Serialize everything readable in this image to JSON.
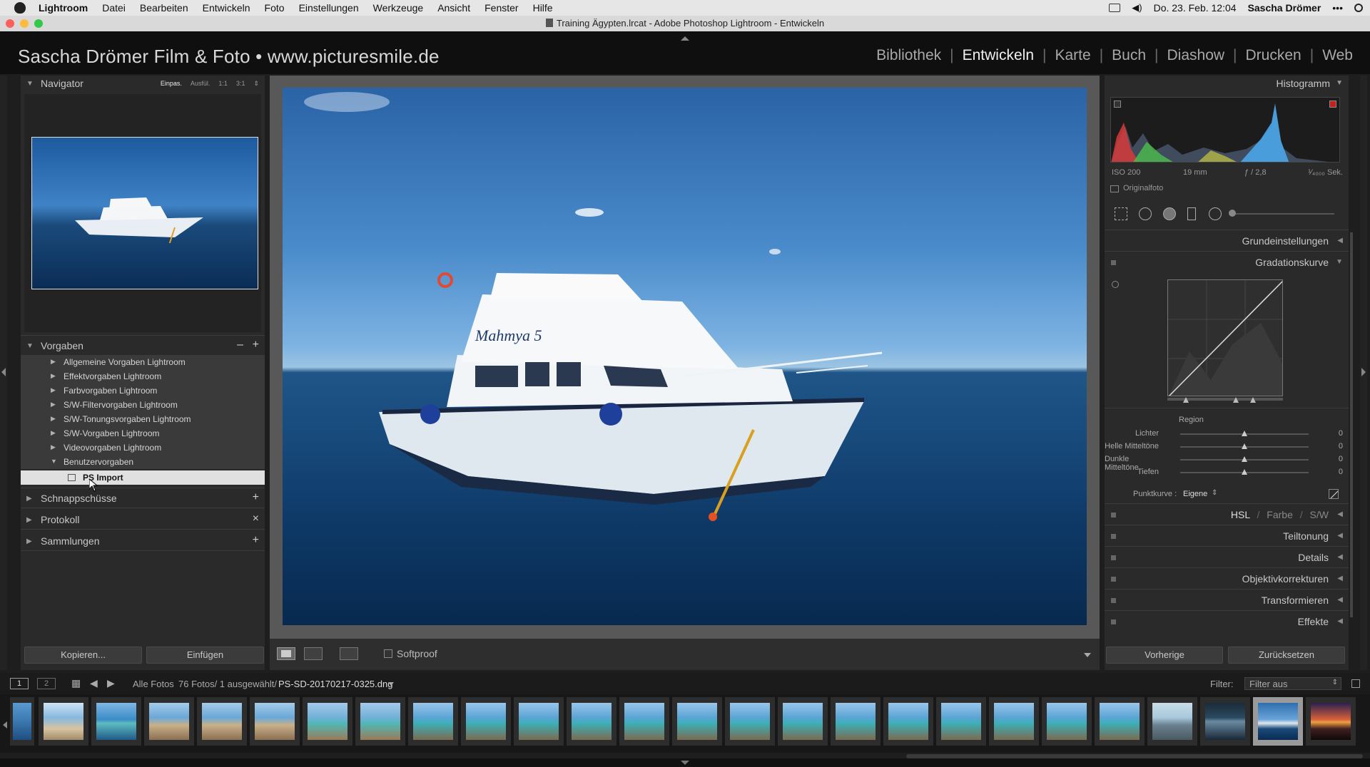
{
  "menubar": {
    "app": "Lightroom",
    "items": [
      "Datei",
      "Bearbeiten",
      "Entwickeln",
      "Foto",
      "Einstellungen",
      "Werkzeuge",
      "Ansicht",
      "Fenster",
      "Hilfe"
    ],
    "clock": "Do. 23. Feb. 12:04",
    "user": "Sascha Drömer",
    "more": "•••"
  },
  "window": {
    "title": "Training Ägypten.lrcat - Adobe Photoshop Lightroom - Entwickeln"
  },
  "identity": {
    "plate": "Sascha Drömer Film & Foto • www.picturesmile.de",
    "modules": [
      {
        "label": "Bibliothek",
        "active": false
      },
      {
        "label": "Entwickeln",
        "active": true
      },
      {
        "label": "Karte",
        "active": false
      },
      {
        "label": "Buch",
        "active": false
      },
      {
        "label": "Diashow",
        "active": false
      },
      {
        "label": "Drucken",
        "active": false
      },
      {
        "label": "Web",
        "active": false
      }
    ],
    "separator": "|"
  },
  "left": {
    "navigator": {
      "title": "Navigator",
      "opts": [
        "Einpas.",
        "Ausfül.",
        "1:1",
        "3:1"
      ]
    },
    "presets": {
      "title": "Vorgaben",
      "minus": "–",
      "plus": "+",
      "folders": [
        "Allgemeine Vorgaben Lightroom",
        "Effektvorgaben Lightroom",
        "Farbvorgaben Lightroom",
        "S/W-Filtervorgaben Lightroom",
        "S/W-Tonungsvorgaben Lightroom",
        "S/W-Vorgaben Lightroom",
        "Videovorgaben Lightroom",
        "Benutzervorgaben"
      ],
      "selected": "PS Import"
    },
    "snapshots": {
      "title": "Schnappschüsse",
      "action": "+"
    },
    "history": {
      "title": "Protokoll",
      "action": "×"
    },
    "collections": {
      "title": "Sammlungen",
      "action": "+"
    },
    "copy_btn": "Kopieren...",
    "paste_btn": "Einfügen"
  },
  "photo": {
    "boat_name": "Mahmya 5"
  },
  "toolbar": {
    "softproof": "Softproof"
  },
  "right": {
    "histogram": {
      "title": "Histogramm",
      "iso": "ISO 200",
      "focal": "19 mm",
      "aperture": "ƒ / 2,8",
      "shutter": "¹⁄₄₀₀₀ Sek.",
      "original": "Originalfoto"
    },
    "basic": "Grundeinstellungen",
    "tonecurve": {
      "title": "Gradationskurve",
      "region": "Region",
      "sliders": [
        {
          "label": "Lichter",
          "value": "0"
        },
        {
          "label": "Helle Mitteltöne",
          "value": "0"
        },
        {
          "label": "Dunkle Mitteltöne",
          "value": "0"
        },
        {
          "label": "Tiefen",
          "value": "0"
        }
      ],
      "pointcurve_label": "Punktkurve :",
      "pointcurve_value": "Eigene"
    },
    "hsl": {
      "hsl": "HSL",
      "farbe": "Farbe",
      "sw": "S/W",
      "sep": "/"
    },
    "sections": [
      "Teiltonung",
      "Details",
      "Objektivkorrekturen",
      "Transformieren",
      "Effekte"
    ],
    "prev_btn": "Vorherige",
    "reset_btn": "Zurücksetzen"
  },
  "filmstrip": {
    "page1": "1",
    "page2": "2",
    "source": "Alle Fotos",
    "count": "76 Fotos/ 1 ausgewählt/",
    "filename": "PS-SD-20170217-0325.dng",
    "filter_label": "Filter:",
    "filter_value": "Filter aus"
  }
}
